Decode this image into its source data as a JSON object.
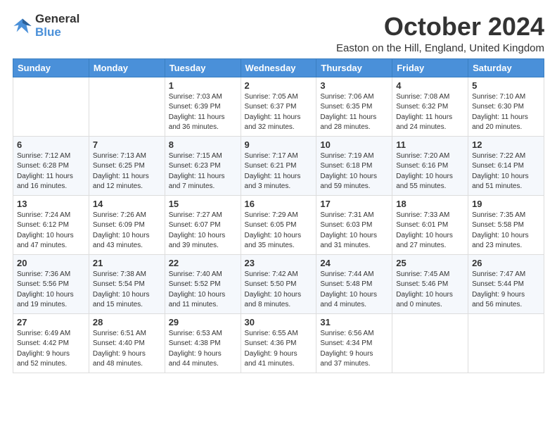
{
  "logo": {
    "line1": "General",
    "line2": "Blue"
  },
  "title": "October 2024",
  "subtitle": "Easton on the Hill, England, United Kingdom",
  "days_of_week": [
    "Sunday",
    "Monday",
    "Tuesday",
    "Wednesday",
    "Thursday",
    "Friday",
    "Saturday"
  ],
  "weeks": [
    [
      {
        "day": "",
        "info": ""
      },
      {
        "day": "",
        "info": ""
      },
      {
        "day": "1",
        "info": "Sunrise: 7:03 AM\nSunset: 6:39 PM\nDaylight: 11 hours\nand 36 minutes."
      },
      {
        "day": "2",
        "info": "Sunrise: 7:05 AM\nSunset: 6:37 PM\nDaylight: 11 hours\nand 32 minutes."
      },
      {
        "day": "3",
        "info": "Sunrise: 7:06 AM\nSunset: 6:35 PM\nDaylight: 11 hours\nand 28 minutes."
      },
      {
        "day": "4",
        "info": "Sunrise: 7:08 AM\nSunset: 6:32 PM\nDaylight: 11 hours\nand 24 minutes."
      },
      {
        "day": "5",
        "info": "Sunrise: 7:10 AM\nSunset: 6:30 PM\nDaylight: 11 hours\nand 20 minutes."
      }
    ],
    [
      {
        "day": "6",
        "info": "Sunrise: 7:12 AM\nSunset: 6:28 PM\nDaylight: 11 hours\nand 16 minutes."
      },
      {
        "day": "7",
        "info": "Sunrise: 7:13 AM\nSunset: 6:25 PM\nDaylight: 11 hours\nand 12 minutes."
      },
      {
        "day": "8",
        "info": "Sunrise: 7:15 AM\nSunset: 6:23 PM\nDaylight: 11 hours\nand 7 minutes."
      },
      {
        "day": "9",
        "info": "Sunrise: 7:17 AM\nSunset: 6:21 PM\nDaylight: 11 hours\nand 3 minutes."
      },
      {
        "day": "10",
        "info": "Sunrise: 7:19 AM\nSunset: 6:18 PM\nDaylight: 10 hours\nand 59 minutes."
      },
      {
        "day": "11",
        "info": "Sunrise: 7:20 AM\nSunset: 6:16 PM\nDaylight: 10 hours\nand 55 minutes."
      },
      {
        "day": "12",
        "info": "Sunrise: 7:22 AM\nSunset: 6:14 PM\nDaylight: 10 hours\nand 51 minutes."
      }
    ],
    [
      {
        "day": "13",
        "info": "Sunrise: 7:24 AM\nSunset: 6:12 PM\nDaylight: 10 hours\nand 47 minutes."
      },
      {
        "day": "14",
        "info": "Sunrise: 7:26 AM\nSunset: 6:09 PM\nDaylight: 10 hours\nand 43 minutes."
      },
      {
        "day": "15",
        "info": "Sunrise: 7:27 AM\nSunset: 6:07 PM\nDaylight: 10 hours\nand 39 minutes."
      },
      {
        "day": "16",
        "info": "Sunrise: 7:29 AM\nSunset: 6:05 PM\nDaylight: 10 hours\nand 35 minutes."
      },
      {
        "day": "17",
        "info": "Sunrise: 7:31 AM\nSunset: 6:03 PM\nDaylight: 10 hours\nand 31 minutes."
      },
      {
        "day": "18",
        "info": "Sunrise: 7:33 AM\nSunset: 6:01 PM\nDaylight: 10 hours\nand 27 minutes."
      },
      {
        "day": "19",
        "info": "Sunrise: 7:35 AM\nSunset: 5:58 PM\nDaylight: 10 hours\nand 23 minutes."
      }
    ],
    [
      {
        "day": "20",
        "info": "Sunrise: 7:36 AM\nSunset: 5:56 PM\nDaylight: 10 hours\nand 19 minutes."
      },
      {
        "day": "21",
        "info": "Sunrise: 7:38 AM\nSunset: 5:54 PM\nDaylight: 10 hours\nand 15 minutes."
      },
      {
        "day": "22",
        "info": "Sunrise: 7:40 AM\nSunset: 5:52 PM\nDaylight: 10 hours\nand 11 minutes."
      },
      {
        "day": "23",
        "info": "Sunrise: 7:42 AM\nSunset: 5:50 PM\nDaylight: 10 hours\nand 8 minutes."
      },
      {
        "day": "24",
        "info": "Sunrise: 7:44 AM\nSunset: 5:48 PM\nDaylight: 10 hours\nand 4 minutes."
      },
      {
        "day": "25",
        "info": "Sunrise: 7:45 AM\nSunset: 5:46 PM\nDaylight: 10 hours\nand 0 minutes."
      },
      {
        "day": "26",
        "info": "Sunrise: 7:47 AM\nSunset: 5:44 PM\nDaylight: 9 hours\nand 56 minutes."
      }
    ],
    [
      {
        "day": "27",
        "info": "Sunrise: 6:49 AM\nSunset: 4:42 PM\nDaylight: 9 hours\nand 52 minutes."
      },
      {
        "day": "28",
        "info": "Sunrise: 6:51 AM\nSunset: 4:40 PM\nDaylight: 9 hours\nand 48 minutes."
      },
      {
        "day": "29",
        "info": "Sunrise: 6:53 AM\nSunset: 4:38 PM\nDaylight: 9 hours\nand 44 minutes."
      },
      {
        "day": "30",
        "info": "Sunrise: 6:55 AM\nSunset: 4:36 PM\nDaylight: 9 hours\nand 41 minutes."
      },
      {
        "day": "31",
        "info": "Sunrise: 6:56 AM\nSunset: 4:34 PM\nDaylight: 9 hours\nand 37 minutes."
      },
      {
        "day": "",
        "info": ""
      },
      {
        "day": "",
        "info": ""
      }
    ]
  ]
}
